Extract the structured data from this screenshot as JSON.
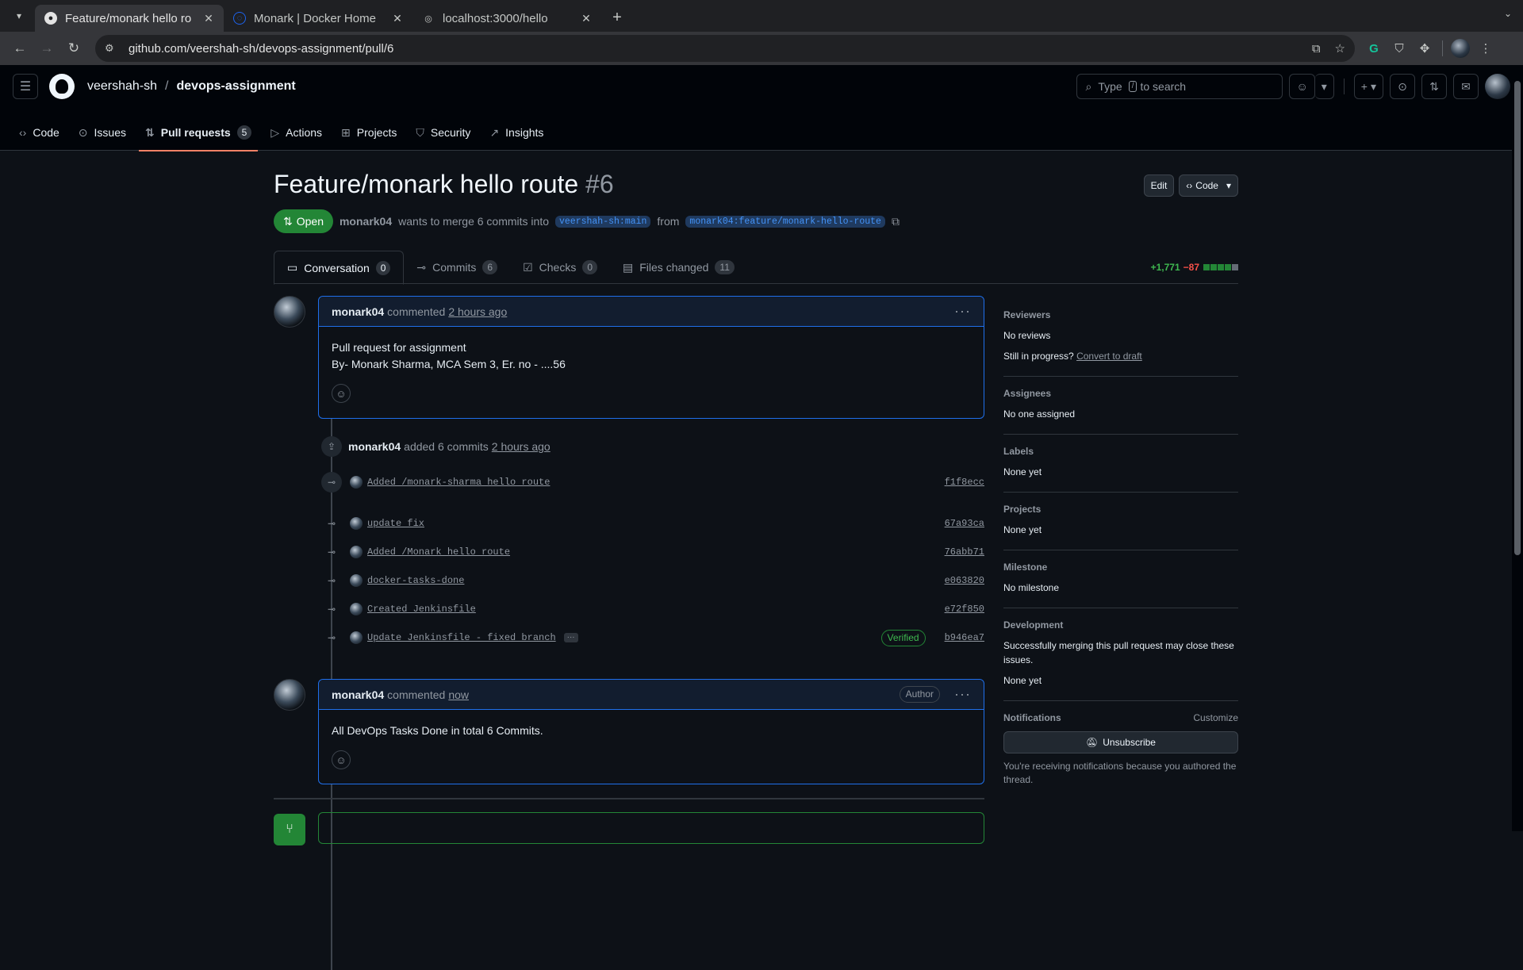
{
  "browser": {
    "tabs": [
      {
        "title": "Feature/monark hello ro",
        "active": true,
        "icon": "github-icon"
      },
      {
        "title": "Monark | Docker Home",
        "active": false,
        "icon": "docker-icon"
      },
      {
        "title": "localhost:3000/hello",
        "active": false,
        "icon": "globe-icon"
      }
    ],
    "url": "github.com/veershah-sh/devops-assignment/pull/6"
  },
  "repo": {
    "owner": "veershah-sh",
    "name": "devops-assignment",
    "search_placeholder": "to search",
    "search_prefix": "Type",
    "search_key": "/",
    "nav": [
      {
        "label": "Code",
        "icon": "code-icon"
      },
      {
        "label": "Issues",
        "icon": "issue-icon"
      },
      {
        "label": "Pull requests",
        "icon": "pull-request-icon",
        "count": "5",
        "selected": true
      },
      {
        "label": "Actions",
        "icon": "play-icon"
      },
      {
        "label": "Projects",
        "icon": "table-icon"
      },
      {
        "label": "Security",
        "icon": "shield-icon"
      },
      {
        "label": "Insights",
        "icon": "graph-icon"
      }
    ]
  },
  "pr": {
    "title": "Feature/monark hello route",
    "number": "#6",
    "edit_label": "Edit",
    "code_label": "Code",
    "state": "Open",
    "author": "monark04",
    "merge_text": "wants to merge 6 commits into",
    "base_branch": "veershah-sh:main",
    "from_text": "from",
    "head_branch": "monark04:feature/monark-hello-route",
    "tabs": [
      {
        "label": "Conversation",
        "count": "0",
        "icon": "comment-icon"
      },
      {
        "label": "Commits",
        "count": "6",
        "icon": "commit-icon"
      },
      {
        "label": "Checks",
        "count": "0",
        "icon": "checklist-icon"
      },
      {
        "label": "Files changed",
        "count": "11",
        "icon": "file-diff-icon"
      }
    ],
    "additions": "+1,771",
    "deletions": "−87"
  },
  "timeline": {
    "first_comment": {
      "author": "monark04",
      "verb": "commented",
      "time": "2 hours ago",
      "body_line1": "Pull request for assignment",
      "body_line2": "By- Monark Sharma, MCA Sem 3, Er. no - ....56"
    },
    "commits_event": {
      "author": "monark04",
      "text": "added 6 commits",
      "time": "2 hours ago"
    },
    "commits": [
      {
        "message": "Added /monark-sharma hello route",
        "sha": "f1f8ecc"
      },
      {
        "message": "update fix",
        "sha": "67a93ca"
      },
      {
        "message": "Added /Monark hello route",
        "sha": "76abb71"
      },
      {
        "message": "docker-tasks-done",
        "sha": "e063820"
      },
      {
        "message": "Created Jenkinsfile",
        "sha": "e72f850"
      },
      {
        "message": "Update Jenkinsfile - fixed branch",
        "sha": "b946ea7",
        "verified": "Verified"
      }
    ],
    "second_comment": {
      "author": "monark04",
      "verb": "commented",
      "time": "now",
      "badge": "Author",
      "body": "All DevOps Tasks Done in total 6 Commits."
    }
  },
  "sidebar": {
    "reviewers": {
      "heading": "Reviewers",
      "value": "No reviews",
      "progress_q": "Still in progress?",
      "draft_link": "Convert to draft"
    },
    "assignees": {
      "heading": "Assignees",
      "value": "No one assigned"
    },
    "labels": {
      "heading": "Labels",
      "value": "None yet"
    },
    "projects": {
      "heading": "Projects",
      "value": "None yet"
    },
    "milestone": {
      "heading": "Milestone",
      "value": "No milestone"
    },
    "development": {
      "heading": "Development",
      "text": "Successfully merging this pull request may close these issues.",
      "value": "None yet"
    },
    "notifications": {
      "heading": "Notifications",
      "customize": "Customize",
      "button": "Unsubscribe",
      "note": "You're receiving notifications because you authored the thread."
    }
  }
}
